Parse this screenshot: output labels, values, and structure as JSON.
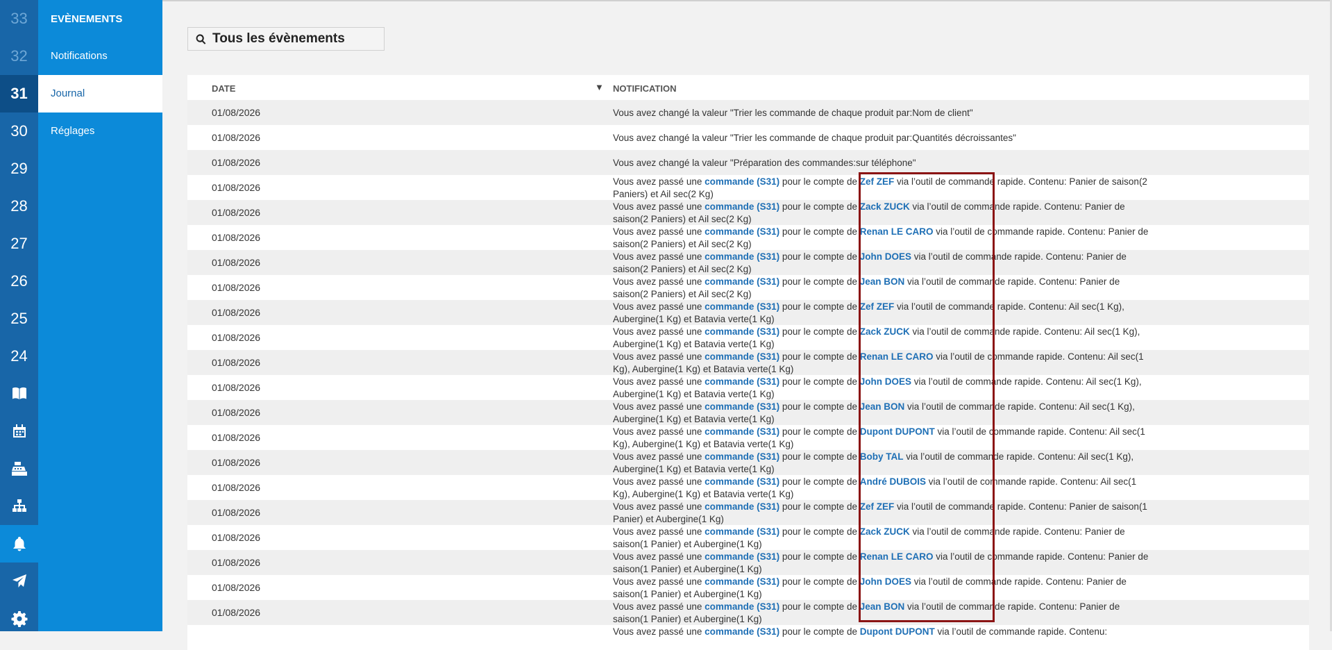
{
  "rail": {
    "weeks": [
      {
        "label": "33",
        "faint": true
      },
      {
        "label": "32",
        "faint": true
      },
      {
        "label": "31",
        "current": true
      },
      {
        "label": "30"
      },
      {
        "label": "29"
      },
      {
        "label": "28"
      },
      {
        "label": "27"
      },
      {
        "label": "26"
      },
      {
        "label": "25"
      },
      {
        "label": "24"
      }
    ],
    "icons": [
      {
        "name": "book-icon"
      },
      {
        "name": "calendar-icon"
      },
      {
        "name": "cash-register-icon"
      },
      {
        "name": "sitemap-icon"
      },
      {
        "name": "bell-icon",
        "active": true
      },
      {
        "name": "paper-plane-icon"
      },
      {
        "name": "gear-icon"
      }
    ]
  },
  "menu": {
    "heading": "EVÈNEMENTS",
    "items": [
      {
        "label": "Notifications"
      },
      {
        "label": "Journal",
        "active": true
      },
      {
        "label": "Réglages"
      }
    ]
  },
  "search": {
    "value": "Tous les évènements"
  },
  "table": {
    "headers": {
      "date": "DATE",
      "sort_indicator": "▼",
      "notification": "NOTIFICATION"
    },
    "prefix": "Vous avez passé une ",
    "order_link": "commande (S31)",
    "mid": " pour le compte de ",
    "tool": " via l’outil de commande rapide. Contenu: ",
    "rows": [
      {
        "date": "01/08/2026",
        "text": "Vous avez changé la valeur \"Trier les commande de chaque produit par:Nom de client\""
      },
      {
        "date": "01/08/2026",
        "text": "Vous avez changé la valeur \"Trier les commande de chaque produit par:Quantités décroissantes\""
      },
      {
        "date": "01/08/2026",
        "text": "Vous avez changé la valeur \"Préparation des commandes:sur téléphone\""
      },
      {
        "date": "01/08/2026",
        "customer": "Zef ZEF",
        "content": "Panier de saison(2 Paniers) et Ail sec(2 Kg)"
      },
      {
        "date": "01/08/2026",
        "customer": "Zack ZUCK",
        "content": "Panier de saison(2 Paniers) et Ail sec(2 Kg)"
      },
      {
        "date": "01/08/2026",
        "customer": "Renan LE CARO",
        "content": "Panier de saison(2 Paniers) et Ail sec(2 Kg)"
      },
      {
        "date": "01/08/2026",
        "customer": "John DOES",
        "content": "Panier de saison(2 Paniers) et Ail sec(2 Kg)"
      },
      {
        "date": "01/08/2026",
        "customer": "Jean BON",
        "content": "Panier de saison(2 Paniers) et Ail sec(2 Kg)"
      },
      {
        "date": "01/08/2026",
        "customer": "Zef ZEF",
        "content": "Ail sec(1 Kg), Aubergine(1 Kg) et Batavia verte(1 Kg)"
      },
      {
        "date": "01/08/2026",
        "customer": "Zack ZUCK",
        "content": "Ail sec(1 Kg), Aubergine(1 Kg) et Batavia verte(1 Kg)"
      },
      {
        "date": "01/08/2026",
        "customer": "Renan LE CARO",
        "content": "Ail sec(1 Kg), Aubergine(1 Kg) et Batavia verte(1 Kg)"
      },
      {
        "date": "01/08/2026",
        "customer": "John DOES",
        "content": "Ail sec(1 Kg), Aubergine(1 Kg) et Batavia verte(1 Kg)"
      },
      {
        "date": "01/08/2026",
        "customer": "Jean BON",
        "content": "Ail sec(1 Kg), Aubergine(1 Kg) et Batavia verte(1 Kg)"
      },
      {
        "date": "01/08/2026",
        "customer": "Dupont DUPONT",
        "content": "Ail sec(1 Kg), Aubergine(1 Kg) et Batavia verte(1 Kg)"
      },
      {
        "date": "01/08/2026",
        "customer": "Boby TAL",
        "content": "Ail sec(1 Kg), Aubergine(1 Kg) et Batavia verte(1 Kg)"
      },
      {
        "date": "01/08/2026",
        "customer": "André DUBOIS",
        "content": "Ail sec(1 Kg), Aubergine(1 Kg) et Batavia verte(1 Kg)"
      },
      {
        "date": "01/08/2026",
        "customer": "Zef ZEF",
        "content": "Panier de saison(1 Panier) et Aubergine(1 Kg)"
      },
      {
        "date": "01/08/2026",
        "customer": "Zack ZUCK",
        "content": "Panier de saison(1 Panier) et Aubergine(1 Kg)"
      },
      {
        "date": "01/08/2026",
        "customer": "Renan LE CARO",
        "content": "Panier de saison(1 Panier) et Aubergine(1 Kg)"
      },
      {
        "date": "01/08/2026",
        "customer": "John DOES",
        "content": "Panier de saison(1 Panier) et Aubergine(1 Kg)"
      },
      {
        "date": "01/08/2026",
        "customer": "Jean BON",
        "content": "Panier de saison(1 Panier) et Aubergine(1 Kg)"
      },
      {
        "date": "",
        "customer": "Dupont DUPONT",
        "content": ""
      }
    ]
  }
}
